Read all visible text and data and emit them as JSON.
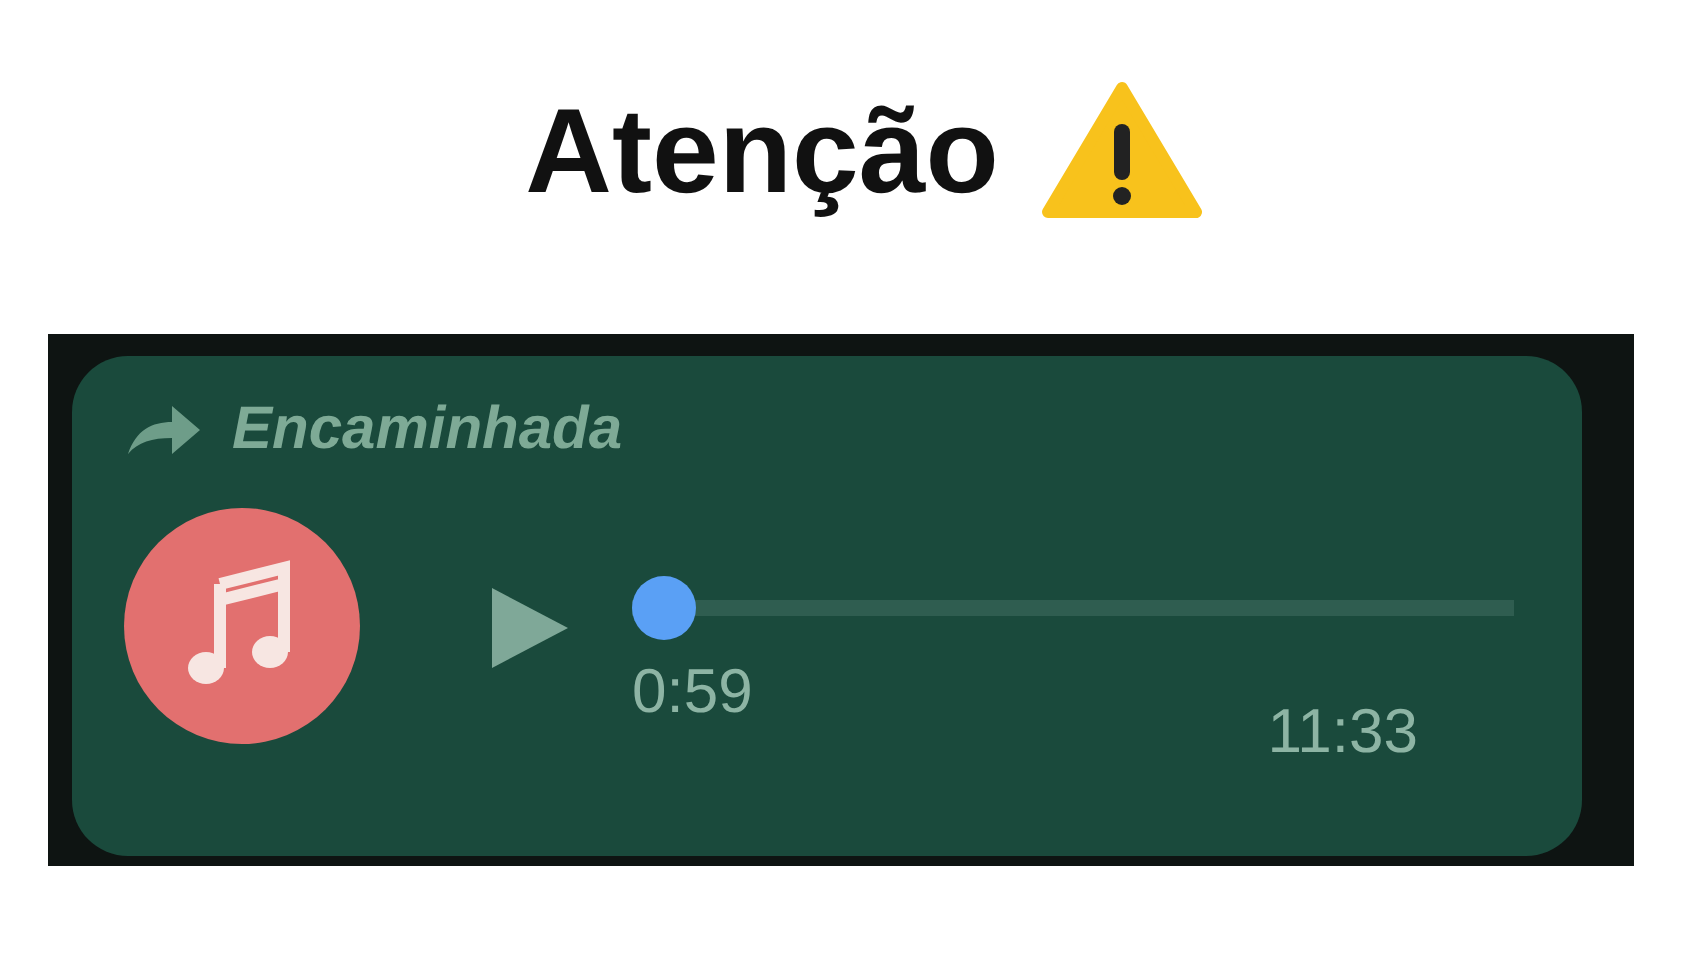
{
  "title": "Atenção",
  "message": {
    "forwarded_label": "Encaminhada",
    "audio": {
      "playing": false,
      "level": 0,
      "duration": "0:59"
    },
    "time": "11:33"
  }
}
